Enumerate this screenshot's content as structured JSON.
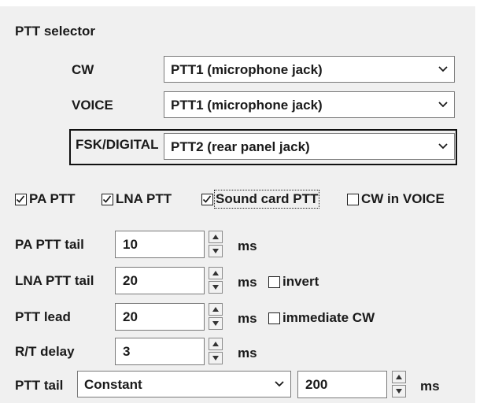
{
  "group_title": "PTT selector",
  "ptt_modes": [
    {
      "label": "CW",
      "value": "PTT1 (microphone jack)"
    },
    {
      "label": "VOICE",
      "value": "PTT1 (microphone jack)"
    },
    {
      "label": "FSK/DIGITAL",
      "value": "PTT2 (rear panel jack)"
    }
  ],
  "checkboxes": [
    {
      "label": "PA PTT",
      "checked": true
    },
    {
      "label": "LNA PTT",
      "checked": true
    },
    {
      "label": "Sound card PTT",
      "checked": true
    },
    {
      "label": "CW in VOICE",
      "checked": false
    }
  ],
  "timing": [
    {
      "label": "PA PTT tail",
      "value": "10",
      "unit": "ms"
    },
    {
      "label": "LNA PTT tail",
      "value": "20",
      "unit": "ms",
      "option": {
        "label": "invert",
        "checked": false
      }
    },
    {
      "label": "PTT lead",
      "value": "20",
      "unit": "ms",
      "option": {
        "label": "immediate CW",
        "checked": false
      }
    },
    {
      "label": "R/T delay",
      "value": "3",
      "unit": "ms"
    }
  ],
  "ptt_tail": {
    "label": "PTT tail",
    "mode": "Constant",
    "value": "200",
    "unit": "ms"
  },
  "icons": {
    "dropdown": "chevron-down-icon",
    "spin_up": "triangle-up-icon",
    "spin_down": "triangle-down-icon",
    "check": "checkmark-icon"
  },
  "colors": {
    "panel_bg": "#f0f0f0",
    "field_bg": "#ffffff",
    "border": "#7a7a7a",
    "text": "#1a1a1a"
  }
}
